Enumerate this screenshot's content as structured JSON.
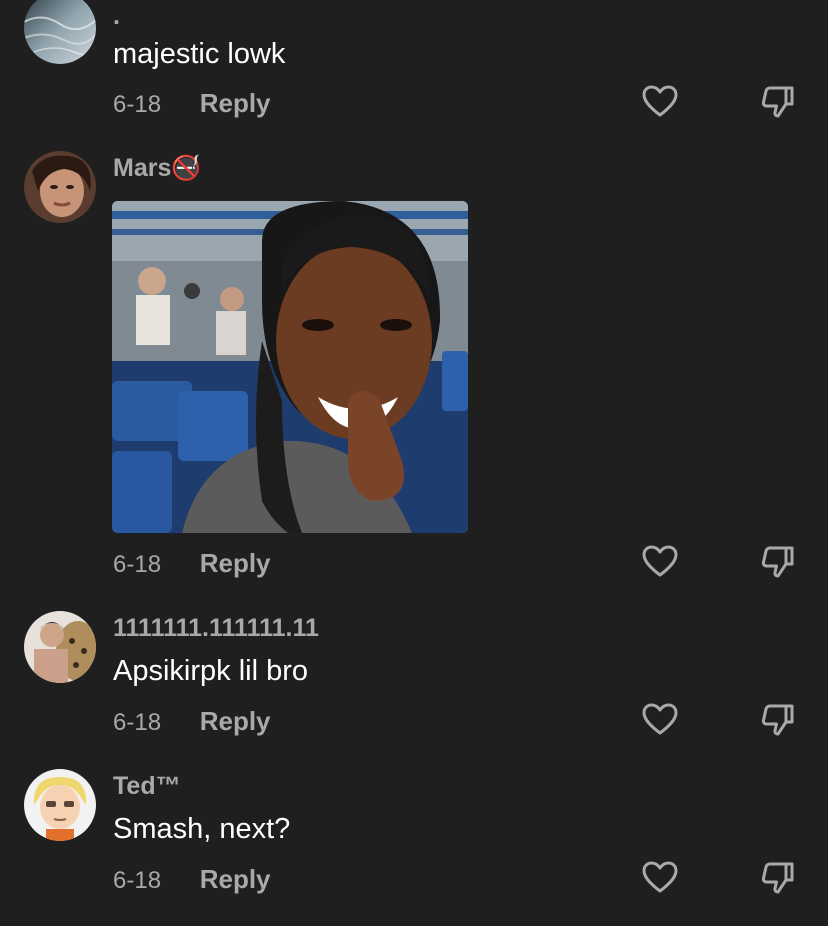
{
  "comments": [
    {
      "username": ".",
      "text": "majestic lowk",
      "date": "6-18",
      "reply_label": "Reply",
      "avatar_icon": "water-photo-avatar",
      "like_icon": "heart-outline-icon",
      "dislike_icon": "thumbs-down-icon"
    },
    {
      "username": "Mars",
      "username_emoji": "🚭",
      "text": "",
      "date": "6-18",
      "reply_label": "Reply",
      "avatar_icon": "woman-selfie-avatar",
      "attachment": "stadium selfie photo",
      "like_icon": "heart-outline-icon",
      "dislike_icon": "thumbs-down-icon"
    },
    {
      "username": "1111111.111111.11",
      "text": "Apsikirpk lil bro",
      "date": "6-18",
      "reply_label": "Reply",
      "avatar_icon": "man-with-leopard-avatar",
      "like_icon": "heart-outline-icon",
      "dislike_icon": "thumbs-down-icon"
    },
    {
      "username": "Ted™",
      "text": "Smash, next?",
      "date": "6-18",
      "reply_label": "Reply",
      "avatar_icon": "cartoon-blonde-avatar",
      "like_icon": "heart-outline-icon",
      "dislike_icon": "thumbs-down-icon"
    }
  ],
  "colors": {
    "background": "#1f1f1f",
    "secondary_text": "#a9a9a9",
    "primary_text": "#ffffff"
  }
}
